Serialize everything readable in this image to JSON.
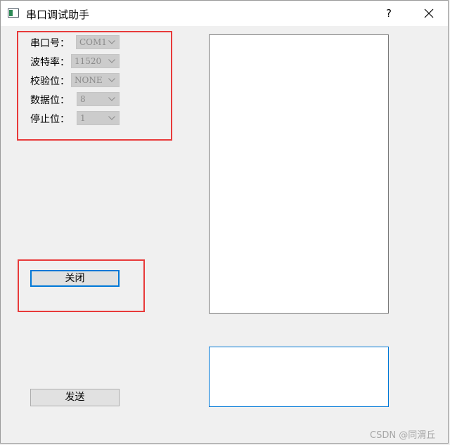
{
  "window": {
    "title": "串口调试助手",
    "help": "?"
  },
  "settings": {
    "port": {
      "label": "串口号：",
      "value": "COM1"
    },
    "baud": {
      "label": "波特率：",
      "value": "11520"
    },
    "parity": {
      "label": "校验位：",
      "value": "NONE"
    },
    "data_bits": {
      "label": "数据位：",
      "value": "8"
    },
    "stop_bits": {
      "label": "停止位：",
      "value": "1"
    }
  },
  "buttons": {
    "toggle_port": "关闭",
    "send": "发送"
  },
  "receive_text": "",
  "send_text": "",
  "watermark": "CSDN @同渭丘",
  "colors": {
    "highlight": "#e83a3a",
    "focus": "#0078d7"
  }
}
